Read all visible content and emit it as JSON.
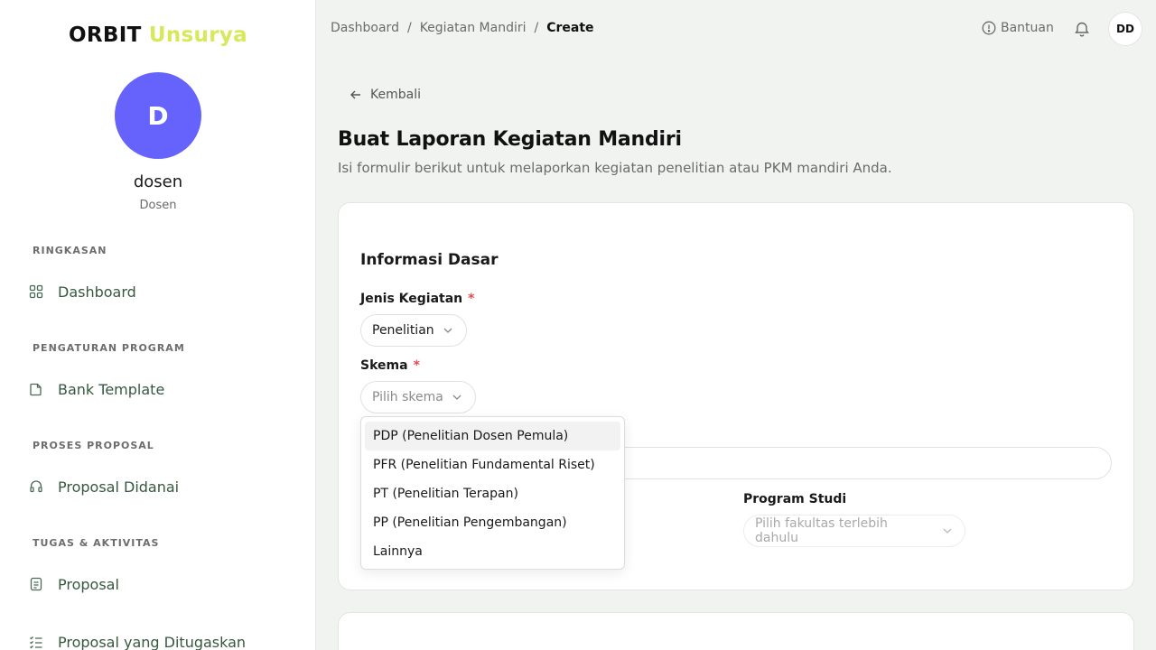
{
  "brand": {
    "part1": "ORBIT",
    "part2": "Unsurya"
  },
  "profile": {
    "initial": "D",
    "name": "dosen",
    "role": "Dosen"
  },
  "sidebar": {
    "sections": [
      {
        "title": "RINGKASAN",
        "items": [
          {
            "label": "Dashboard",
            "icon": "grid-icon"
          }
        ]
      },
      {
        "title": "PENGATURAN PROGRAM",
        "items": [
          {
            "label": "Bank Template",
            "icon": "file-icon"
          }
        ]
      },
      {
        "title": "PROSES PROPOSAL",
        "items": [
          {
            "label": "Proposal Didanai",
            "icon": "headset-icon"
          }
        ]
      },
      {
        "title": "TUGAS & AKTIVITAS",
        "items": [
          {
            "label": "Proposal",
            "icon": "document-icon"
          },
          {
            "label": "Proposal yang Ditugaskan",
            "icon": "checklist-icon"
          }
        ]
      }
    ]
  },
  "topbar": {
    "breadcrumb": [
      "Dashboard",
      "Kegiatan Mandiri",
      "Create"
    ],
    "separator": "/",
    "help_label": "Bantuan",
    "user_initials": "DD"
  },
  "page": {
    "back_label": "Kembali",
    "title": "Buat Laporan Kegiatan Mandiri",
    "subtitle": "Isi formulir berikut untuk melaporkan kegiatan penelitian atau PKM mandiri Anda."
  },
  "form": {
    "section_title": "Informasi Dasar",
    "required_mark": "*",
    "jenis_kegiatan": {
      "label": "Jenis Kegiatan",
      "value": "Penelitian"
    },
    "skema": {
      "label": "Skema",
      "placeholder": "Pilih skema"
    },
    "program_studi": {
      "label": "Program Studi",
      "placeholder": "Pilih fakultas terlebih dahulu"
    }
  },
  "dropdown": {
    "options": [
      "PDP (Penelitian Dosen Pemula)",
      "PFR (Penelitian Fundamental Riset)",
      "PT (Penelitian Terapan)",
      "PP (Penelitian Pengembangan)",
      "Lainnya"
    ],
    "highlighted_index": 0
  },
  "colors": {
    "brand_accent": "#d7e85a",
    "avatar_bg": "#6563fb",
    "nav_text": "#36583f",
    "required": "#e5484d",
    "page_bg": "#f1f3f1"
  }
}
